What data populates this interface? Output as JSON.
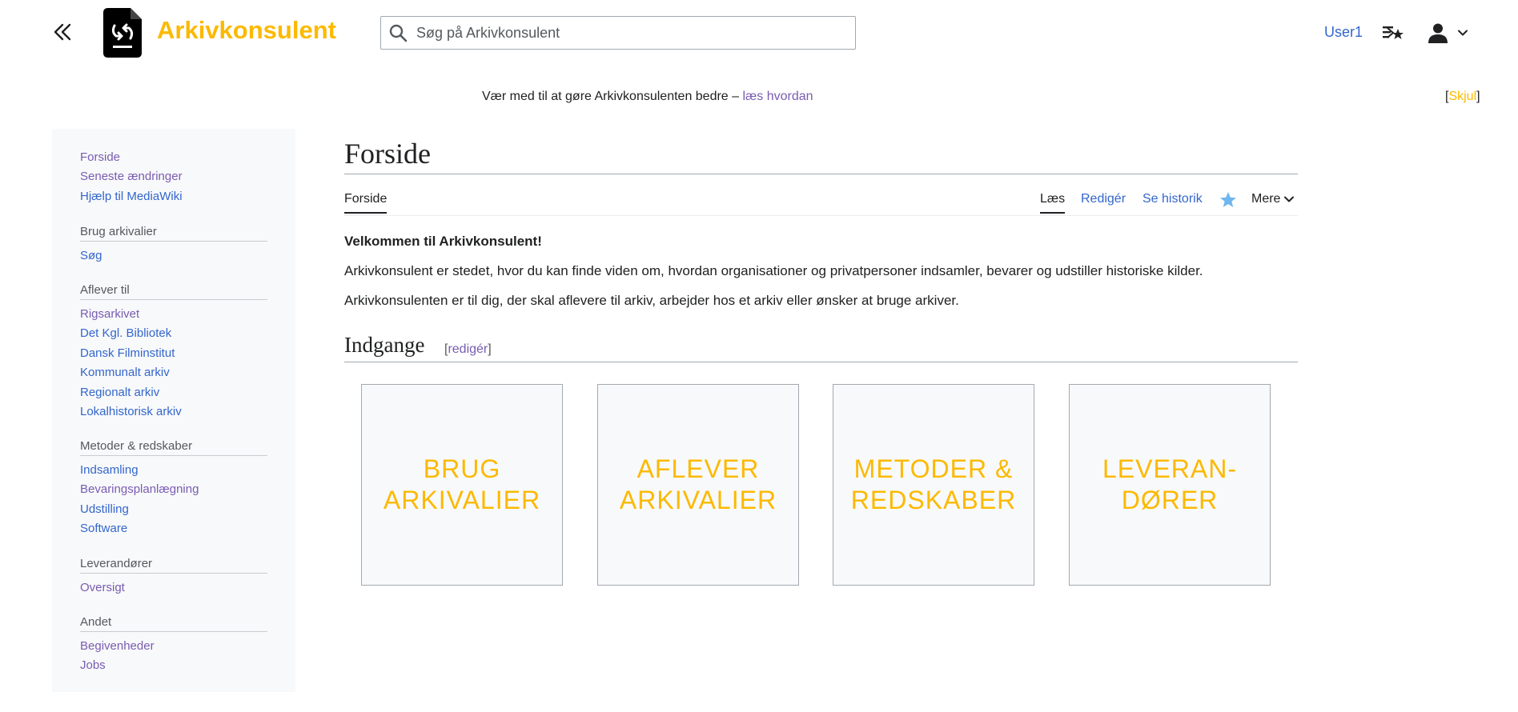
{
  "header": {
    "site_title": "Arkivkonsulent",
    "search_placeholder": "Søg på Arkivkonsulent",
    "user_name": "User1"
  },
  "sitenotice": {
    "text": "Vær med til at gøre Arkivkonsulenten bedre – ",
    "link": "læs hvordan",
    "dismiss_open": "[",
    "dismiss_label": "Skjul",
    "dismiss_close": "]"
  },
  "sidebar": {
    "top_links": [
      "Forside",
      "Seneste ændringer",
      "Hjælp til MediaWiki"
    ],
    "groups": [
      {
        "heading": "Brug arkivalier",
        "links": [
          "Søg"
        ]
      },
      {
        "heading": "Aflever til",
        "links": [
          "Rigsarkivet",
          "Det Kgl. Bibliotek",
          "Dansk Filminstitut",
          "Kommunalt arkiv",
          "Regionalt arkiv",
          "Lokalhistorisk arkiv"
        ]
      },
      {
        "heading": "Metoder & redskaber",
        "links": [
          "Indsamling",
          "Bevaringsplanlægning",
          "Udstilling",
          "Software"
        ]
      },
      {
        "heading": "Leverandører",
        "links": [
          "Oversigt"
        ]
      },
      {
        "heading": "Andet",
        "links": [
          "Begivenheder",
          "Jobs"
        ]
      }
    ]
  },
  "page": {
    "title": "Forside",
    "namespace_tab": "Forside",
    "views": [
      "Læs",
      "Redigér",
      "Se historik"
    ],
    "more": "Mere",
    "welcome": "Velkommen til Arkivkonsulent!",
    "para1": "Arkivkonsulent er stedet, hvor du kan finde viden om, hvordan organisationer og privatpersoner indsamler, bevarer og udstiller historiske kilder.",
    "para2": "Arkivkonsulenten er til dig, der skal aflevere til arkiv, arbejder hos et arkiv eller ønsker at bruge arkiver.",
    "section_title": "Indgange",
    "section_edit_open": "[",
    "section_edit": "redigér",
    "section_edit_close": "]",
    "tiles": [
      {
        "line1": "BRUG",
        "line2": "ARKIVALIER"
      },
      {
        "line1": "AFLEVER",
        "line2": "ARKIVALIER"
      },
      {
        "line1": "METODER &",
        "line2": "REDSKABER"
      },
      {
        "line1": "LEVERAN-",
        "line2": "DØRER"
      }
    ]
  },
  "colors": {
    "brand": "#fcb900",
    "link": "#3366cc",
    "visited": "#795cb2"
  }
}
